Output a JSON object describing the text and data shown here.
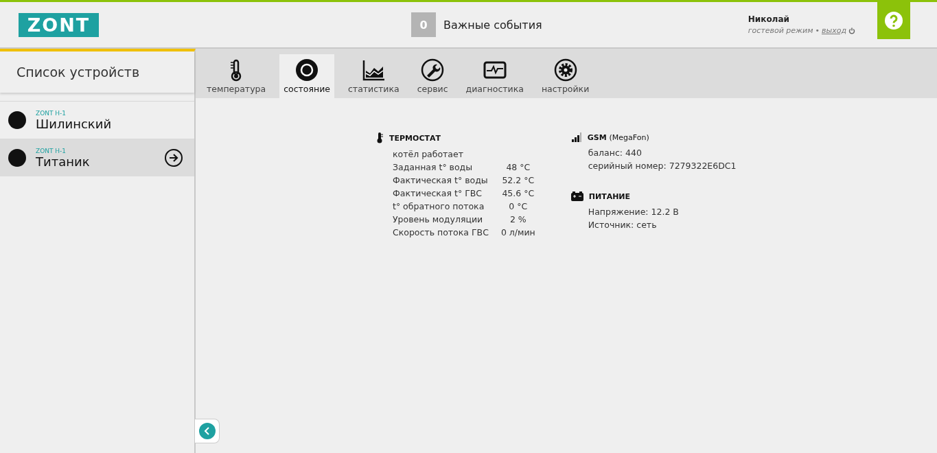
{
  "header": {
    "logo": "ZONT",
    "events": {
      "count": "0",
      "label": "Важные события"
    },
    "user": {
      "name": "Николай",
      "mode": "гостевой режим",
      "separator": "•",
      "logout": "выход"
    }
  },
  "sidebar": {
    "title": "Список устройств",
    "devices": [
      {
        "model": "ZONT H-1",
        "name": "Шилинский",
        "selected": false
      },
      {
        "model": "ZONT H-1",
        "name": "Титаник",
        "selected": true
      }
    ]
  },
  "tabs": [
    {
      "kind": "thermometer",
      "label": "температура",
      "selected": false
    },
    {
      "kind": "state",
      "label": "состояние",
      "selected": true
    },
    {
      "kind": "chart",
      "label": "статистика",
      "selected": false
    },
    {
      "kind": "wrench",
      "label": "сервис",
      "selected": false
    },
    {
      "kind": "pulse",
      "label": "диагностика",
      "selected": false
    },
    {
      "kind": "gear",
      "label": "настройки",
      "selected": false
    }
  ],
  "thermostat": {
    "title": "ТЕРМОСТАТ",
    "status": "котёл работает",
    "rows": [
      {
        "label": "Заданная t° воды",
        "value": "48 °C"
      },
      {
        "label": "Фактическая t° воды",
        "value": "52.2 °C"
      },
      {
        "label": "Фактическая t° ГВС",
        "value": "45.6 °C"
      },
      {
        "label": "t° обратного потока",
        "value": "0 °C"
      },
      {
        "label": "Уровень модуляции",
        "value": "2 %"
      },
      {
        "label": "Скорость потока ГВС",
        "value": "0 л/мин"
      }
    ]
  },
  "gsm": {
    "title": "GSM",
    "operator": "(MegaFon)",
    "lines": [
      "баланс: 440",
      "серийный номер: 7279322E6DC1"
    ]
  },
  "power": {
    "title": "ПИТАНИЕ",
    "lines": [
      "Напряжение: 12.2 В",
      "Источник: сеть"
    ]
  }
}
